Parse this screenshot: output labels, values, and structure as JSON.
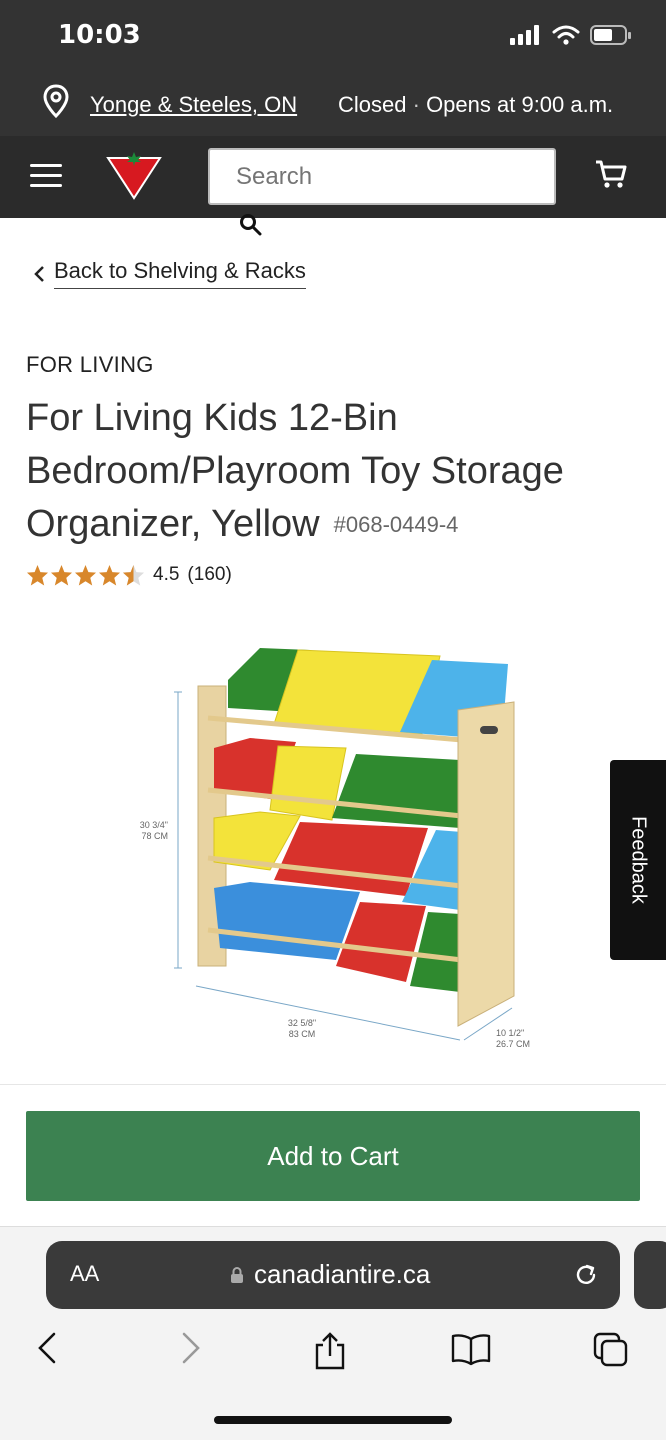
{
  "status_bar": {
    "time": "10:03"
  },
  "store_bar": {
    "store_name": "Yonge & Steeles, ON",
    "status": "Closed",
    "separator": "·",
    "opens": "Opens at 9:00 a.m."
  },
  "nav": {
    "search_placeholder": "Search"
  },
  "back_link": {
    "label": "Back to Shelving & Racks"
  },
  "product": {
    "brand": "FOR LIVING",
    "title": "For Living Kids 12-Bin Bedroom/Playroom Toy Storage Organizer, Yellow",
    "sku": "#068-0449-4",
    "rating_value": "4.5",
    "rating_count": "(160)",
    "rating_stars": 4.5,
    "dimensions": {
      "height_in": "30 3/4\"",
      "height_cm": "78 CM",
      "width_in": "32 5/8\"",
      "width_cm": "83 CM",
      "depth_in": "10 1/2\"",
      "depth_cm": "26.7 CM"
    }
  },
  "feedback_tab": {
    "label": "Feedback"
  },
  "cart": {
    "add_label": "Add to Cart"
  },
  "browser": {
    "aa_label": "AA",
    "domain": "canadiantire.ca"
  },
  "colors": {
    "accent_green": "#3c8251",
    "star_orange": "#d8872b",
    "header_dark": "#333333"
  }
}
